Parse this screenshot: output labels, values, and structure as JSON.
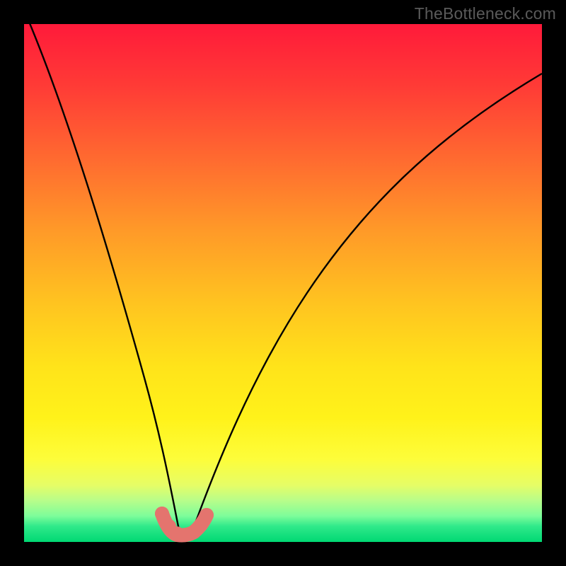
{
  "watermark": "TheBottleneck.com",
  "colors": {
    "frame_bg": "#000000",
    "gradient_top": "#ff1a3a",
    "gradient_bottom": "#00d873",
    "curve": "#000000",
    "markers": "#e4746e"
  },
  "chart_data": {
    "type": "line",
    "title": "",
    "xlabel": "",
    "ylabel": "",
    "xlim": [
      0,
      100
    ],
    "ylim": [
      0,
      100
    ],
    "grid": false,
    "legend": false,
    "annotations": [
      "TheBottleneck.com"
    ],
    "series": [
      {
        "name": "bottleneck-curve",
        "x": [
          0,
          4,
          8,
          12,
          16,
          20,
          24,
          26,
          28,
          30,
          32,
          34,
          38,
          44,
          50,
          58,
          66,
          74,
          82,
          90,
          100
        ],
        "y": [
          102,
          88,
          74,
          60,
          46,
          32,
          16,
          8,
          2,
          0,
          2,
          8,
          20,
          36,
          48,
          60,
          70,
          78,
          84,
          88,
          91
        ]
      }
    ],
    "markers": {
      "name": "highlighted-minimum",
      "x": [
        25.5,
        27,
        28.5,
        30,
        31.5,
        33,
        34.5
      ],
      "y": [
        5.5,
        2.5,
        1,
        0.5,
        1,
        2.5,
        5.5
      ]
    }
  }
}
